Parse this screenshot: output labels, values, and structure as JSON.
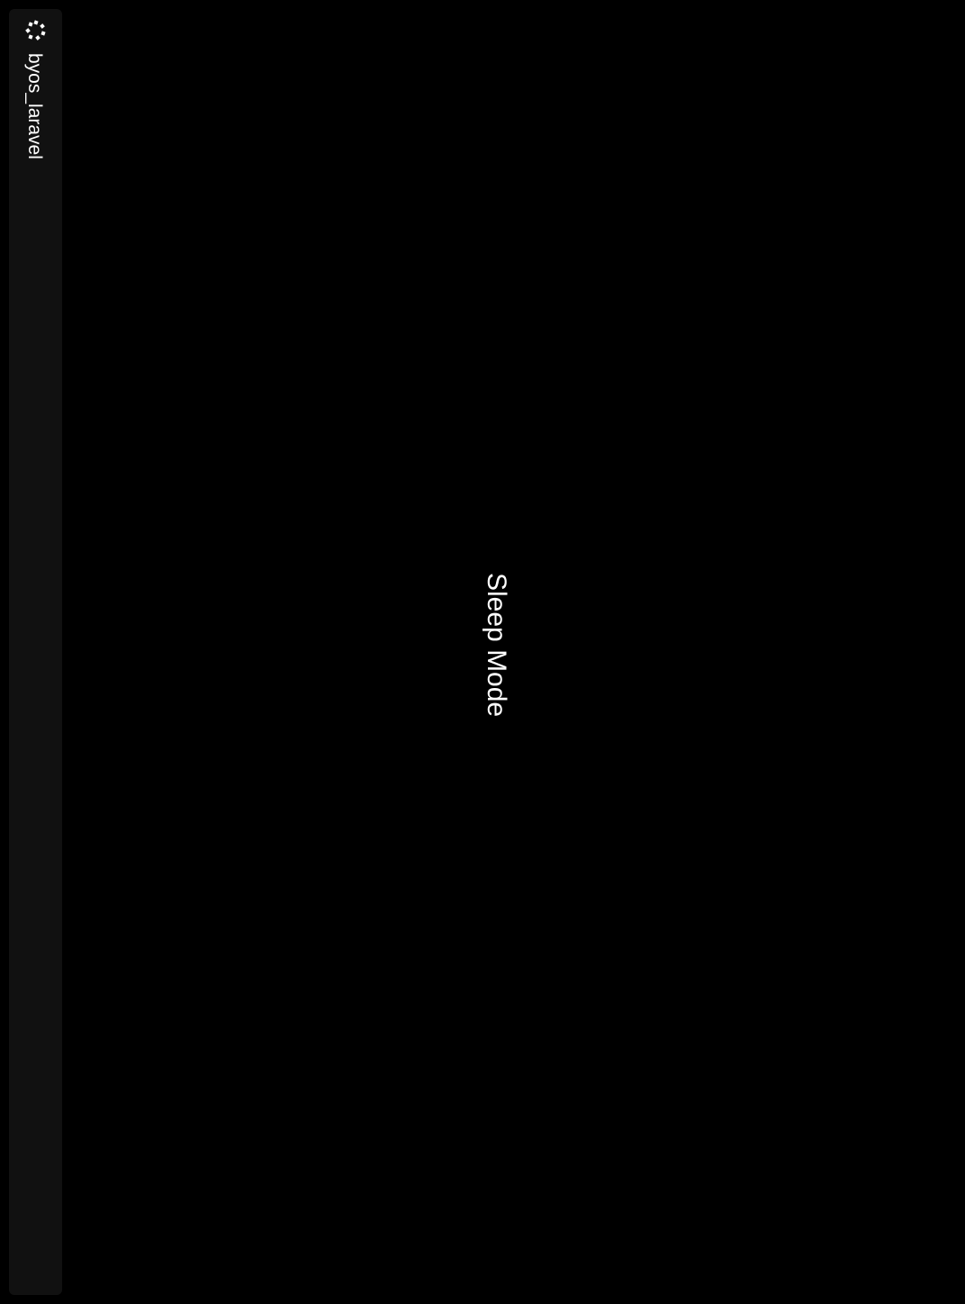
{
  "sidebar": {
    "icon": "trmnl-logo-icon",
    "label": "byos_laravel"
  },
  "main": {
    "message": "Sleep Mode"
  },
  "colors": {
    "background": "#000000",
    "sidebar": "#111111",
    "text": "#ffffff"
  }
}
